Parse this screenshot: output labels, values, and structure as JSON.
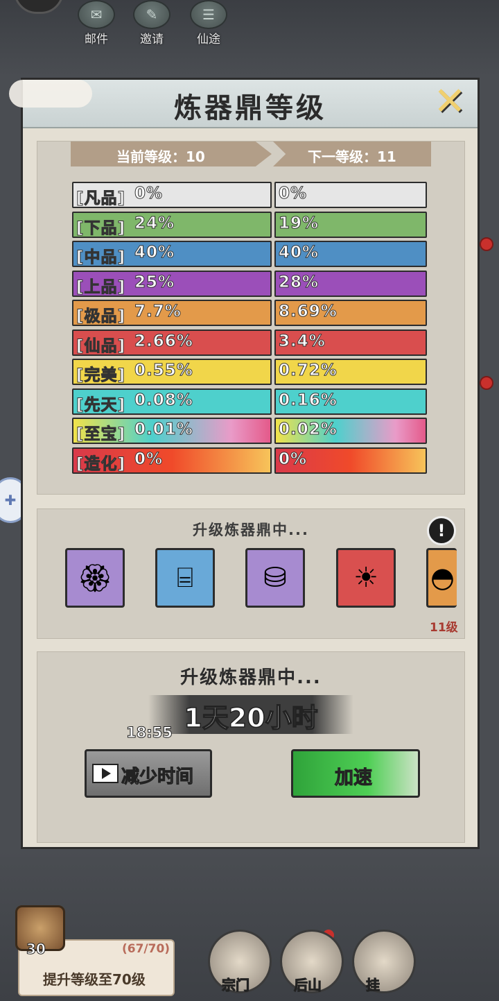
{
  "top_icons": [
    {
      "label": "邮件",
      "icon": "mail-icon"
    },
    {
      "label": "邀请",
      "icon": "invite-icon"
    },
    {
      "label": "仙途",
      "icon": "journey-icon"
    }
  ],
  "dialog": {
    "title": "炼器鼎等级",
    "close_icon": "close-icon",
    "current_level_label": "当前等级：10",
    "next_level_label": "下一等级：11",
    "tiers": [
      {
        "name": "[凡品]",
        "current": "0%",
        "next": "0%",
        "color": "#e6e6e6",
        "text_color": "#f4f4f4"
      },
      {
        "name": "[下品]",
        "current": "24%",
        "next": "19%",
        "color": "#7fb76a",
        "text_color": "#ffffff"
      },
      {
        "name": "[中品]",
        "current": "40%",
        "next": "40%",
        "color": "#4f8fc4",
        "text_color": "#ffffff"
      },
      {
        "name": "[上品]",
        "current": "25%",
        "next": "28%",
        "color": "#9b4fb9",
        "text_color": "#ffffff"
      },
      {
        "name": "[极品]",
        "current": "7.7%",
        "next": "8.69%",
        "color": "#e39a4a",
        "text_color": "#ffffff"
      },
      {
        "name": "[仙品]",
        "current": "2.66%",
        "next": "3.4%",
        "color": "#d94e4e",
        "text_color": "#ffffff"
      },
      {
        "name": "[完美]",
        "current": "0.55%",
        "next": "0.72%",
        "color": "#f1d64a",
        "text_color": "#ffffff"
      },
      {
        "name": "[先天]",
        "current": "0.08%",
        "next": "0.16%",
        "color": "#4ed0cc",
        "text_color": "#ffffff"
      },
      {
        "name": "[至宝]",
        "current": "0.01%",
        "next": "0.02%",
        "color": "gradient-rainbow",
        "text_color": "#ffffff"
      },
      {
        "name": "[造化]",
        "current": "0%",
        "next": "0%",
        "color": "gradient-fire",
        "text_color": "#ffffff"
      }
    ],
    "materials_title": "升级炼器鼎中...",
    "materials": [
      {
        "icon": "gold-charm-icon"
      },
      {
        "icon": "treasure-box-icon"
      },
      {
        "icon": "rice-sack-icon"
      },
      {
        "icon": "golden-orb-icon"
      },
      {
        "icon": "porridge-bowl-icon"
      }
    ],
    "material_level_label": "11级",
    "upgrade_title": "升级炼器鼎中...",
    "timer": "1天20小时",
    "clock": "18:55",
    "reduce_button": "减少时间",
    "speed_button": "加速"
  },
  "bottom": {
    "chest_count": "30",
    "task_progress": "(67/70)",
    "task_text": "提升等级至70级",
    "nav": [
      {
        "label": "宗门",
        "icon": "sect-gate-icon"
      },
      {
        "label": "后山",
        "icon": "mountain-icon"
      },
      {
        "label": "挂",
        "icon": "partial-nav-icon"
      }
    ]
  }
}
